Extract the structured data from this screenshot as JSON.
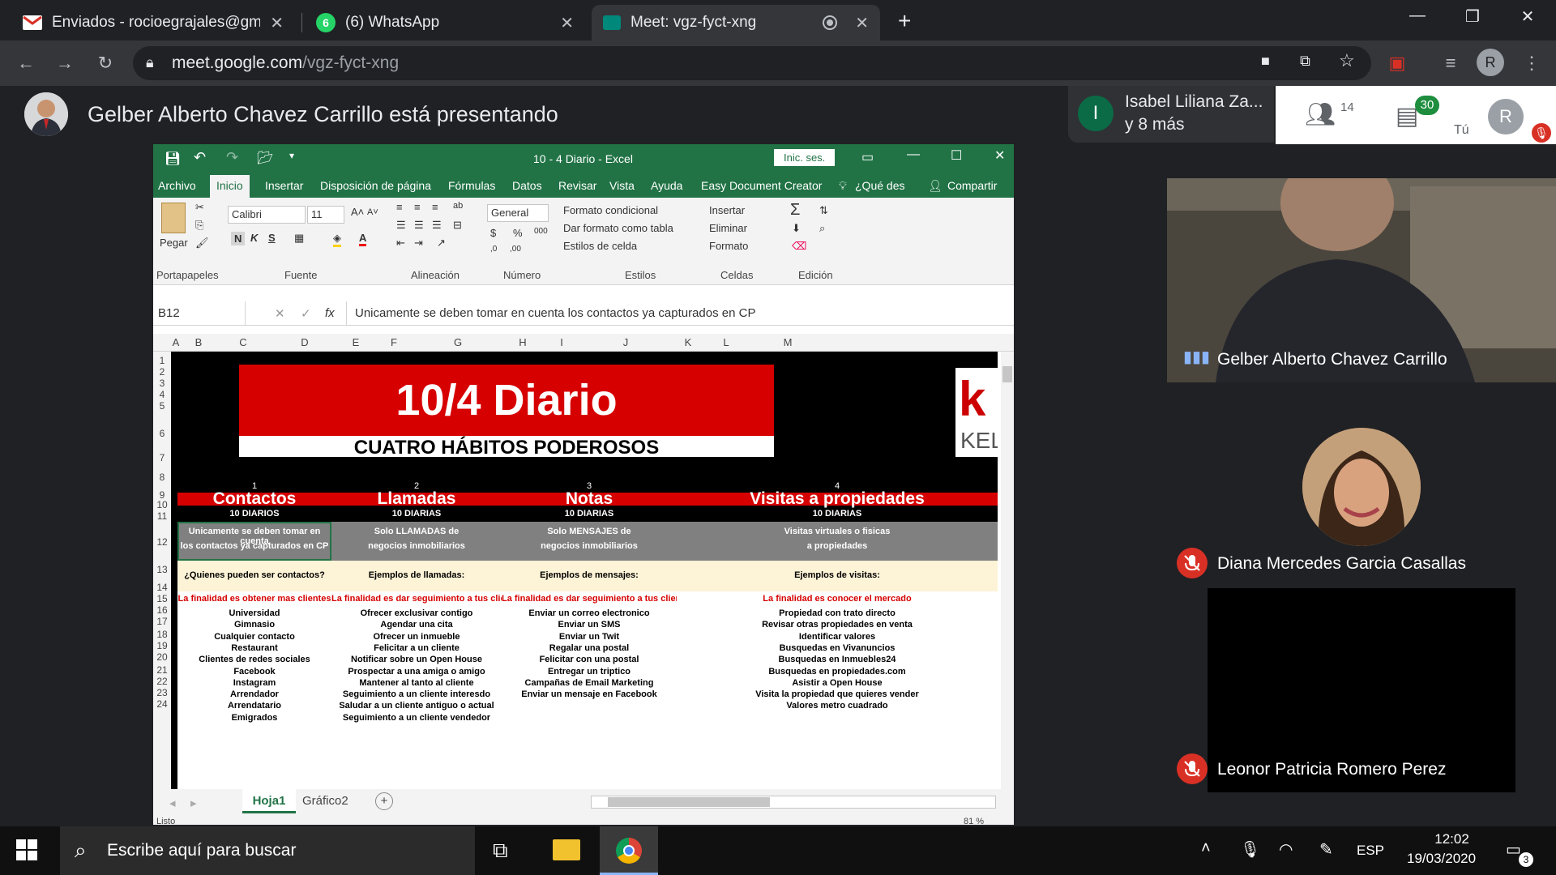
{
  "browser": {
    "tabs": [
      {
        "title": "Enviados - rocioegrajales@gmail",
        "icon": "gmail-icon"
      },
      {
        "title": "(6) WhatsApp",
        "icon": "whatsapp-icon",
        "badge": "6"
      },
      {
        "title": "Meet: vgz-fyct-xng",
        "icon": "meet-icon"
      }
    ],
    "url_host": "meet.google.com",
    "url_path": "/vgz-fyct-xng"
  },
  "meet": {
    "presenting_text": "Gelber Alberto Chavez Carrillo está presentando",
    "chip_initial": "I",
    "chip_line1": "Isabel Liliana Za...",
    "chip_line2": "y 8 más",
    "people_count": "14",
    "chat_count": "30",
    "self_label": "Tú",
    "self_initial": "R",
    "participants": [
      {
        "name": "Gelber Alberto Chavez Carrillo",
        "muted": false
      },
      {
        "name": "Diana Mercedes Garcia Casallas",
        "muted": true
      },
      {
        "name": "Leonor Patricia Romero Perez",
        "muted": true
      }
    ]
  },
  "excel": {
    "title": "10 - 4 Diario  -  Excel",
    "signin": "Inic. ses.",
    "menu": [
      "Archivo",
      "Inicio",
      "Insertar",
      "Disposición de página",
      "Fórmulas",
      "Datos",
      "Revisar",
      "Vista",
      "Ayuda",
      "Easy Document Creator",
      "¿Qué des",
      "Compartir"
    ],
    "ribbon": {
      "paste": "Pegar",
      "font_name": "Calibri",
      "font_size": "11",
      "number_format": "General",
      "cond_format": "Formato condicional",
      "format_table": "Dar formato como tabla",
      "cell_styles": "Estilos de celda",
      "insert": "Insertar",
      "delete": "Eliminar",
      "format": "Formato",
      "groups": [
        "Portapapeles",
        "Fuente",
        "Alineación",
        "Número",
        "Estilos",
        "Celdas",
        "Edición"
      ]
    },
    "cell_ref": "B12",
    "formula": "Unicamente se deben tomar en cuenta los contactos ya capturados en CP",
    "columns": [
      "A",
      "B",
      "C",
      "D",
      "E",
      "F",
      "G",
      "H",
      "I",
      "J",
      "K",
      "L",
      "M"
    ],
    "rows": [
      "1",
      "2",
      "3",
      "4",
      "5",
      "6",
      "7",
      "8",
      "9",
      "10",
      "11",
      "12",
      "13",
      "14",
      "15",
      "16",
      "17",
      "18",
      "19",
      "20",
      "21",
      "22",
      "23",
      "24"
    ],
    "banner_title": "10/4 Diario",
    "banner_subtitle": "CUATRO HÁBITOS PODEROSOS",
    "logo_text": "KEL",
    "habits": [
      {
        "num": "1",
        "title": "Contactos",
        "count": "10 DIARIOS",
        "desc1": "Unicamente se deben tomar en cuenta",
        "desc2": "los contactos ya capturados en CP",
        "header": "¿Quienes pueden ser contactos?",
        "goal": "La finalidad es obtener mas clientes",
        "items": [
          "Universidad",
          "Gimnasio",
          "Cualquier contacto",
          "Restaurant",
          "Clientes de redes sociales",
          "Facebook",
          "Instagram",
          "Arrendador",
          "Arrendatario",
          "Emigrados"
        ]
      },
      {
        "num": "2",
        "title": "Llamadas",
        "count": "10 DIARIAS",
        "desc1": "Solo LLAMADAS de",
        "desc2": "negocios inmobiliarios",
        "header": "Ejemplos de llamadas:",
        "goal": "La finalidad es dar seguimiento a tus clientes",
        "items": [
          "Ofrecer exclusivar contigo",
          "Agendar una cita",
          "Ofrecer un inmueble",
          "Felicitar a un cliente",
          "Notificar sobre un Open House",
          "Prospectar a una amiga o amigo",
          "Mantener al tanto al cliente",
          "Seguimiento a un cliente interesdo",
          "Saludar a un cliente antiguo o actual",
          "Seguimiento a un cliente vendedor"
        ]
      },
      {
        "num": "3",
        "title": "Notas",
        "count": "10 DIARIAS",
        "desc1": "Solo MENSAJES de",
        "desc2": "negocios inmobiliarios",
        "header": "Ejemplos de mensajes:",
        "goal": "La finalidad es dar seguimiento a tus clientes",
        "items": [
          "Enviar un correo electronico",
          "Enviar un SMS",
          "Enviar un Twit",
          "Regalar una postal",
          "Felicitar con una postal",
          "Entregar un triptico",
          "Campañas de Email Marketing",
          "Enviar un mensaje en Facebook"
        ]
      },
      {
        "num": "4",
        "title": "Visitas a propiedades",
        "count": "10 DIARIAS",
        "desc1": "Visitas virtuales o fisicas",
        "desc2": "a propiedades",
        "header": "Ejemplos de visitas:",
        "goal": "La finalidad es conocer el mercado",
        "items": [
          "Propiedad con trato directo",
          "Revisar otras propiedades en venta",
          "Identificar valores",
          "Busquedas en Vivanuncios",
          "Busquedas en Inmuebles24",
          "Busquedas en propiedades.com",
          "Asistir a Open House",
          "Visita la propiedad que quieres vender",
          "Valores metro cuadrado"
        ]
      }
    ],
    "sheet_tabs": [
      "Hoja1",
      "Gráfico2"
    ],
    "status": "Listo",
    "zoom": "81 %"
  },
  "taskbar": {
    "search_placeholder": "Escribe aquí para buscar",
    "lang": "ESP",
    "time": "12:02",
    "date": "19/03/2020",
    "notif_count": "3"
  }
}
